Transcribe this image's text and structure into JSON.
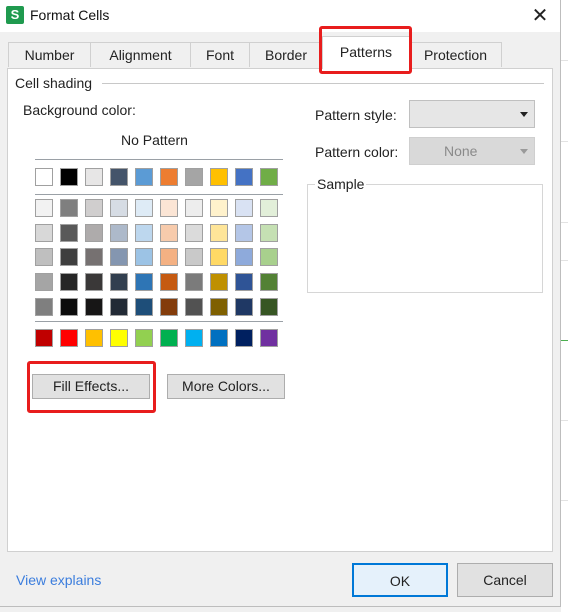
{
  "window": {
    "title": "Format Cells",
    "app_icon": "S"
  },
  "tabs": [
    {
      "label": "Number"
    },
    {
      "label": "Alignment"
    },
    {
      "label": "Font"
    },
    {
      "label": "Border"
    },
    {
      "label": "Patterns",
      "active": true
    },
    {
      "label": "Protection"
    }
  ],
  "cell_shading": {
    "group_label": "Cell shading",
    "background_color_label": "Background color:",
    "no_pattern_label": "No Pattern",
    "standard_row": [
      "#ffffff",
      "#000000",
      "#e7e6e6",
      "#44546a",
      "#5b9bd5",
      "#ed7d31",
      "#a5a5a5",
      "#ffc000",
      "#4472c4",
      "#70ad47"
    ],
    "shade_rows": [
      [
        "#f2f2f2",
        "#7f7f7f",
        "#d0cece",
        "#d6dce4",
        "#deebf6",
        "#fbe5d5",
        "#ededed",
        "#fff2cc",
        "#d9e2f3",
        "#e2efd9"
      ],
      [
        "#d8d8d8",
        "#595959",
        "#aeabab",
        "#adb9ca",
        "#bdd7ee",
        "#f7cbac",
        "#dbdbdb",
        "#fee599",
        "#b4c6e7",
        "#c5e0b3"
      ],
      [
        "#bfbfbf",
        "#3f3f3f",
        "#767171",
        "#8496b0",
        "#9cc3e5",
        "#f4b183",
        "#c9c9c9",
        "#ffd965",
        "#8eaadb",
        "#a8d08d"
      ],
      [
        "#a5a5a5",
        "#262626",
        "#3a3838",
        "#323f4f",
        "#2e75b5",
        "#c55a11",
        "#7b7b7b",
        "#bf9000",
        "#2f5496",
        "#538135"
      ],
      [
        "#7f7f7f",
        "#0c0c0c",
        "#171616",
        "#222a35",
        "#1e4e79",
        "#833c0b",
        "#525252",
        "#7f6000",
        "#1f3864",
        "#375623"
      ]
    ],
    "bright_row": [
      "#c00000",
      "#ff0000",
      "#ffc000",
      "#ffff00",
      "#92d050",
      "#00b050",
      "#00b0f0",
      "#0070c0",
      "#002060",
      "#7030a0"
    ],
    "fill_effects_button": "Fill Effects...",
    "more_colors_button": "More Colors..."
  },
  "pattern": {
    "style_label": "Pattern style:",
    "style_value": "",
    "color_label": "Pattern color:",
    "color_value": "None",
    "sample_label": "Sample"
  },
  "footer": {
    "view_explains": "View explains",
    "ok": "OK",
    "cancel": "Cancel"
  },
  "highlight_color": "#e81d1d"
}
